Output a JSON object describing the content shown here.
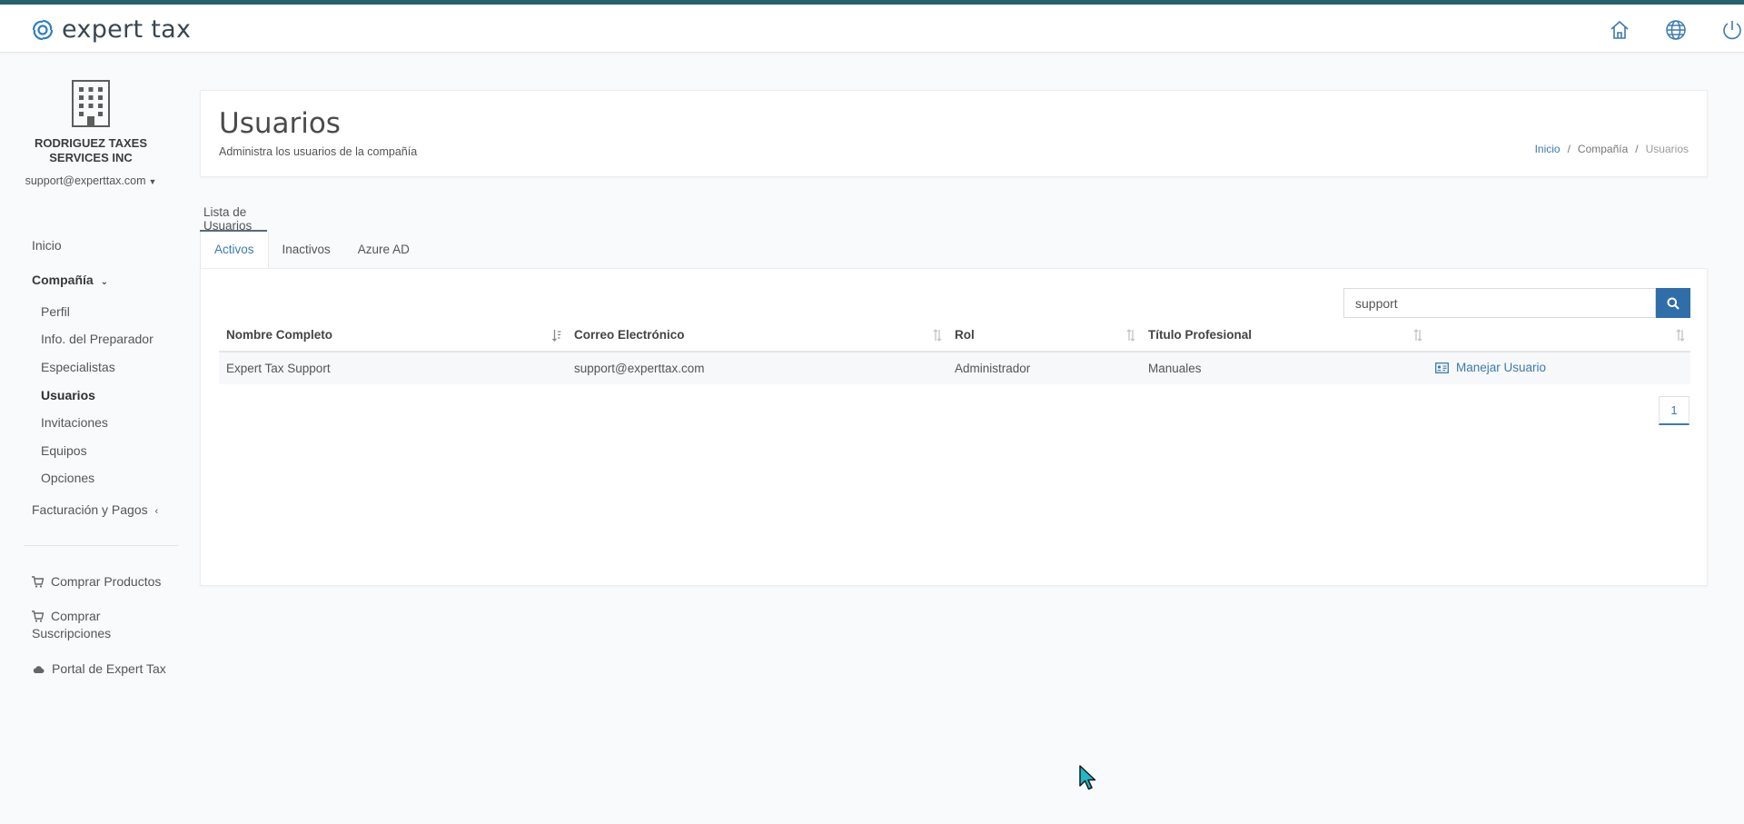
{
  "brand": {
    "name": "expert tax",
    "accent": "#23636b",
    "link_color": "#3d7ab0",
    "button_color": "#2f6ea8"
  },
  "topbar": {
    "icons": [
      "home-icon",
      "globe-icon",
      "power-icon"
    ]
  },
  "sidebar": {
    "company_name": "RODRIGUEZ TAXES SERVICES INC",
    "user_email": "support@experttax.com",
    "nav": {
      "inicio": "Inicio",
      "compania": "Compañía",
      "sub": [
        "Perfil",
        "Info. del Preparador",
        "Especialistas",
        "Usuarios",
        "Invitaciones",
        "Equipos",
        "Opciones"
      ],
      "active_sub": "Usuarios",
      "facturacion": "Facturación y Pagos"
    },
    "shop": {
      "productos": "Comprar Productos",
      "suscripciones_1": "Comprar",
      "suscripciones_2": "Suscripciones",
      "portal": "Portal de Expert Tax"
    }
  },
  "header": {
    "title": "Usuarios",
    "subtitle": "Administra los usuarios de la compañía",
    "breadcrumb": [
      "Inicio",
      "Compañía",
      "Usuarios"
    ]
  },
  "list": {
    "title": "Lista de Usuarios",
    "tabs": [
      "Activos",
      "Inactivos",
      "Azure AD"
    ],
    "active_tab": "Activos",
    "search_value": "support",
    "columns": [
      "Nombre Completo",
      "Correo Electrónico",
      "Rol",
      "Título Profesional",
      ""
    ],
    "rows": [
      {
        "name": "Expert Tax Support",
        "email": "support@experttax.com",
        "role": "Administrador",
        "title": "Manuales",
        "action": "Manejar Usuario"
      }
    ],
    "pagination": [
      "1"
    ]
  }
}
